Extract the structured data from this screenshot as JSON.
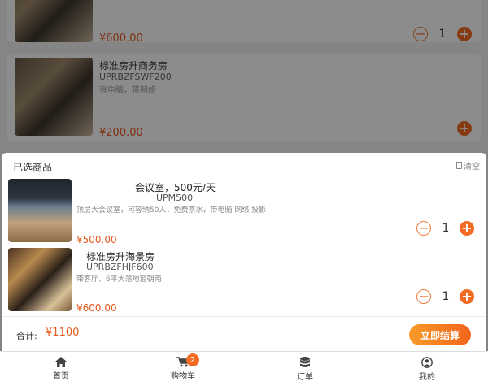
{
  "background_list": {
    "items": [
      {
        "price": "¥600.00",
        "quantity": "1"
      },
      {
        "title": "标准房升商务房",
        "code": "UPRBZFSWF200",
        "desc": "有电脑，带网络",
        "price": "¥200.00"
      }
    ]
  },
  "cart_panel": {
    "title": "已选商品",
    "clear_label": "清空",
    "items": [
      {
        "name": "会议室，500元/天",
        "code": "UPM500",
        "desc": "顶层大会议室，可容纳50人，免费茶水，带电脑 网络 投影",
        "price": "¥500.00",
        "quantity": "1"
      },
      {
        "name": "标准房升海景房",
        "code": "UPRBZFHJF600",
        "desc": "带客厅，6平大落地窗朝南",
        "price": "¥600.00",
        "quantity": "1"
      }
    ],
    "total_label": "合计:",
    "total_value": "¥1100",
    "checkout_label": "立即结算"
  },
  "tabbar": {
    "tabs": [
      {
        "label": "首页",
        "icon": "home-icon"
      },
      {
        "label": "购物车",
        "icon": "cart-icon",
        "badge": "2"
      },
      {
        "label": "订单",
        "icon": "database-icon"
      },
      {
        "label": "我的",
        "icon": "user-icon"
      }
    ]
  },
  "colors": {
    "accent": "#f26b22",
    "price": "#e55b20",
    "checkout_gradient_start": "#f89a28",
    "checkout_gradient_end": "#f2641c"
  }
}
